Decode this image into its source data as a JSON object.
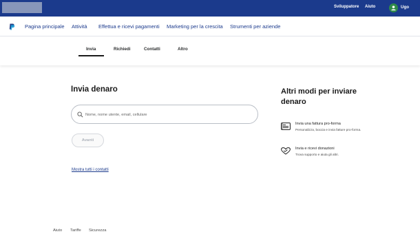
{
  "topbar": {
    "developer": "Sviluppatore",
    "help": "Aiuto",
    "user": "Ugo"
  },
  "nav": {
    "items": [
      "Pagina principale",
      "Attività",
      "Effettua e ricevi pagamenti",
      "Marketing per la crescita",
      "Strumenti per aziende"
    ]
  },
  "tabs": [
    "Invia",
    "Richiedi",
    "Contatti",
    "Altro"
  ],
  "main": {
    "title": "Invia denaro",
    "search_placeholder": "Nome, nome utente, email, cellulare",
    "next_button": "Avanti",
    "show_all_link": "Mostra tutti i contatti"
  },
  "side": {
    "title": "Altri modi per inviare denaro",
    "options": [
      {
        "title": "Invia una fattura pro-forma",
        "desc": "Personalizza, boccia e invia fatture pro-forma.",
        "icon": "invoice-icon"
      },
      {
        "title": "Invia e ricevi donazioni",
        "desc": "Trova supporto e aiuta gli altri.",
        "icon": "heart-donation-icon"
      }
    ]
  },
  "footer": [
    "Aiuto",
    "Tariffe",
    "Sicurezza"
  ],
  "colors": {
    "brand_blue": "#1b3a8c",
    "topbar": "#1b3a8c",
    "avatar_green": "#2f8a4a"
  }
}
